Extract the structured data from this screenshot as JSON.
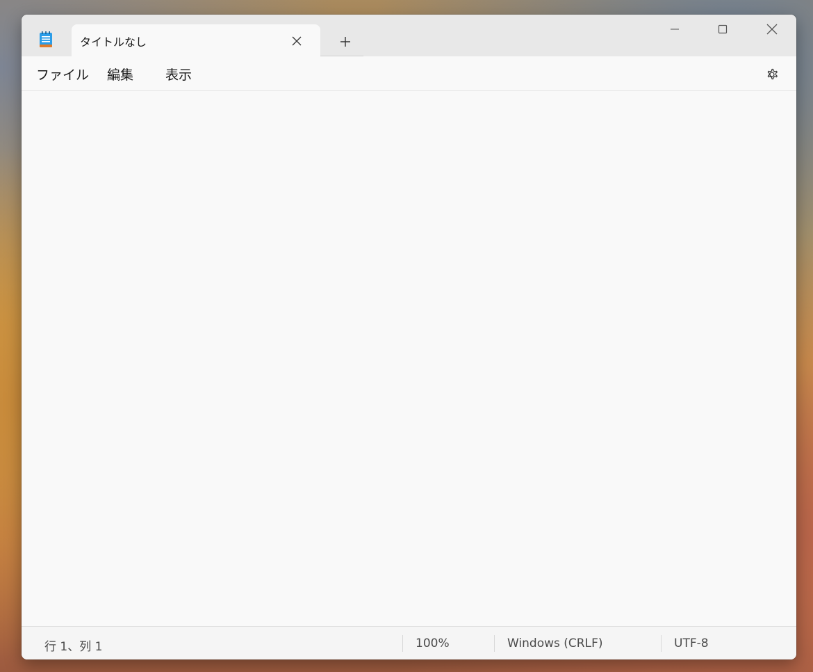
{
  "tab": {
    "title": "タイトルなし"
  },
  "menu": {
    "file": "ファイル",
    "edit": "編集",
    "view": "表示"
  },
  "editor": {
    "content": ""
  },
  "status": {
    "position": "行 1、列 1",
    "zoom": "100%",
    "line_ending": "Windows (CRLF)",
    "encoding": "UTF-8"
  },
  "icons": {
    "app": "notepad-icon",
    "close_tab": "close-icon",
    "new_tab": "plus-icon",
    "minimize": "minimize-icon",
    "maximize": "maximize-icon",
    "close": "close-icon",
    "settings": "gear-icon"
  },
  "colors": {
    "accent": "#1e88e5",
    "window_bg": "#f9f9f9",
    "titlebar_bg": "#e8e8e8"
  }
}
